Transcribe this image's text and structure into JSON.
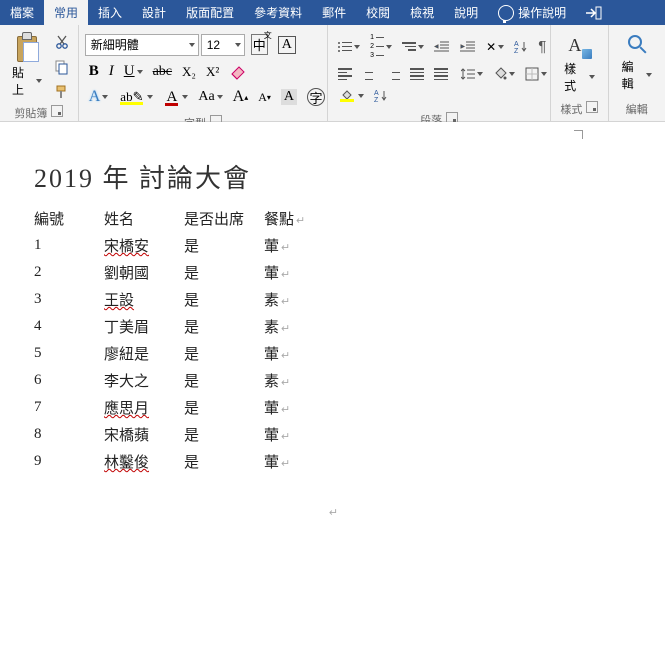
{
  "tabs": {
    "file": "檔案",
    "home": "常用",
    "insert": "插入",
    "design": "設計",
    "layout": "版面配置",
    "references": "參考資料",
    "mailings": "郵件",
    "review": "校閱",
    "view": "檢視",
    "help": "說明",
    "tell": "操作說明"
  },
  "ribbon": {
    "clipboard": {
      "label": "剪貼簿",
      "paste": "貼上"
    },
    "font": {
      "label": "字型",
      "family": "新細明體",
      "size": "12",
      "phonetic": "中",
      "charborder": "A",
      "bold": "B",
      "italic": "I",
      "underline": "U",
      "strike": "abc",
      "sub": "X₂",
      "sup": "X²",
      "effects": "A",
      "highlight": "ab",
      "fontcolor": "A",
      "case": "Aa",
      "grow": "A",
      "shrink": "A",
      "clear": "A"
    },
    "paragraph": {
      "label": "段落"
    },
    "styles": {
      "label": "樣式",
      "btn": "樣式"
    },
    "editing": {
      "label": "編輯",
      "btn": "編輯"
    }
  },
  "document": {
    "title": "2019 年 討論大會",
    "headers": [
      "編號",
      "姓名",
      "是否出席",
      "餐點"
    ],
    "rows": [
      {
        "num": "1",
        "name": "宋橋安",
        "wavy": true,
        "attend": "是",
        "meal": "葷"
      },
      {
        "num": "2",
        "name": "劉朝國",
        "wavy": false,
        "attend": "是",
        "meal": "葷"
      },
      {
        "num": "3",
        "name": "王設",
        "wavy": true,
        "attend": "是",
        "meal": "素"
      },
      {
        "num": "4",
        "name": "丁美眉",
        "wavy": false,
        "attend": "是",
        "meal": "素"
      },
      {
        "num": "5",
        "name": "廖紐是",
        "wavy": false,
        "attend": "是",
        "meal": "葷"
      },
      {
        "num": "6",
        "name": "李大之",
        "wavy": false,
        "attend": "是",
        "meal": "素"
      },
      {
        "num": "7",
        "name": "應思月",
        "wavy": true,
        "attend": "是",
        "meal": "葷"
      },
      {
        "num": "8",
        "name": "宋橋蘋",
        "wavy": false,
        "attend": "是",
        "meal": "葷"
      },
      {
        "num": "9",
        "name": "林鑿俊",
        "wavy": true,
        "attend": "是",
        "meal": "葷"
      }
    ]
  }
}
